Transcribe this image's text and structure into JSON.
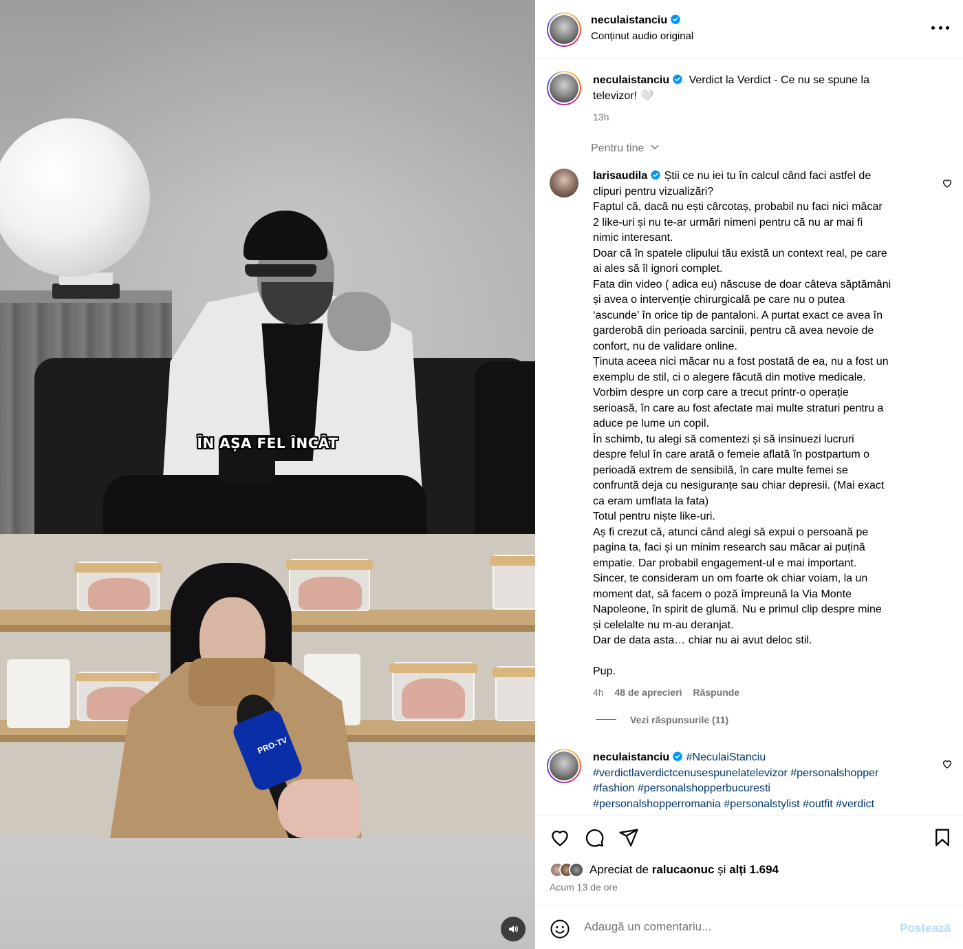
{
  "video": {
    "subtitle": "ÎN AȘA FEL ÎNCÂT",
    "mic_brand": "PRO-TV",
    "mute_icon": "speaker-icon"
  },
  "header": {
    "username": "neculaistanciu",
    "audio_label": "Conținut audio original",
    "more_icon": "more-horizontal-icon"
  },
  "caption": {
    "username": "neculaistanciu",
    "text": "Verdict la Verdict - Ce nu se spune la televizor! 🤍",
    "time": "13h"
  },
  "sort": {
    "label": "Pentru tine"
  },
  "comment": {
    "username": "larisaudila",
    "lines": [
      "Știi ce nu iei tu în calcul când faci astfel de",
      "clipuri pentru vizualizări?",
      "Faptul că, dacă nu ești cârcotaș, probabil nu faci nici măcar",
      "2 like-uri și nu te-ar urmări nimeni pentru că nu ar mai fi",
      "nimic interesant.",
      "Doar că în spatele clipului tău există un context real, pe care",
      "ai ales să îl ignori complet.",
      "Fata din video ( adica eu) născuse de doar câteva săptămâni",
      "și avea o intervenție chirurgicală pe care nu o putea",
      "‘ascunde’ în orice tip de pantaloni. A purtat exact ce avea în",
      "garderobă din perioada sarcinii, pentru că avea nevoie de",
      "confort, nu de validare online.",
      "Ținuta aceea nici măcar nu a fost postată de ea, nu a fost un",
      "exemplu de stil, ci o alegere făcută din motive medicale.",
      "Vorbim despre un corp care a trecut printr-o operație",
      "serioasă, în care au fost afectate mai multe straturi pentru a",
      "aduce pe lume un copil.",
      "În schimb, tu alegi să comentezi și să insinuezi lucruri",
      "despre felul în care arată o femeie aflată în postpartum o",
      "perioadă extrem de sensibilă, în care multe femei se",
      "confruntă deja cu nesiguranțe sau chiar depresii. (Mai exact",
      "ca eram umflata la fata)",
      "Totul pentru niște like-uri.",
      "Aș fi crezut că, atunci când alegi să expui o persoană pe",
      "pagina ta, faci și un minim research sau măcar ai puțină",
      "empatie. Dar probabil engagement-ul e mai important.",
      "Sincer, te consideram un om foarte ok chiar voiam, la un",
      "moment dat, să facem o poză împreună la Via Monte",
      "Napoleone, în spirit de glumă. Nu e primul clip despre mine",
      "și celelalte nu m-au deranjat.",
      "Dar de data asta… chiar nu ai avut deloc stil.",
      "",
      "Pup."
    ],
    "time": "4h",
    "likes": "48 de aprecieri",
    "reply": "Răspunde",
    "view_replies": "Vezi răspunsurile (11)"
  },
  "hashtag_comment": {
    "username": "neculaistanciu",
    "tags_line1": "#NeculaiStanciu",
    "tags_line2": "#verdictlaverdictcenusespunelatelevizor #personalshopper",
    "tags_line3": "#fashion #personalshopperbucuresti",
    "tags_line4": "#personalshopperromania #personalstylist #outfit #verdict"
  },
  "actions": {
    "liked_prefix": "Apreciat de",
    "liked_user": "ralucaonuc",
    "liked_and": "și",
    "liked_others": "alți 1.694",
    "time_ago": "Acum 13 de ore"
  },
  "add_comment": {
    "placeholder": "Adaugă un comentariu...",
    "post_label": "Postează"
  },
  "colors": {
    "verified": "#0095f6",
    "hashtag": "#00376b",
    "muted": "#737373",
    "post_disabled": "#b3dbff"
  }
}
